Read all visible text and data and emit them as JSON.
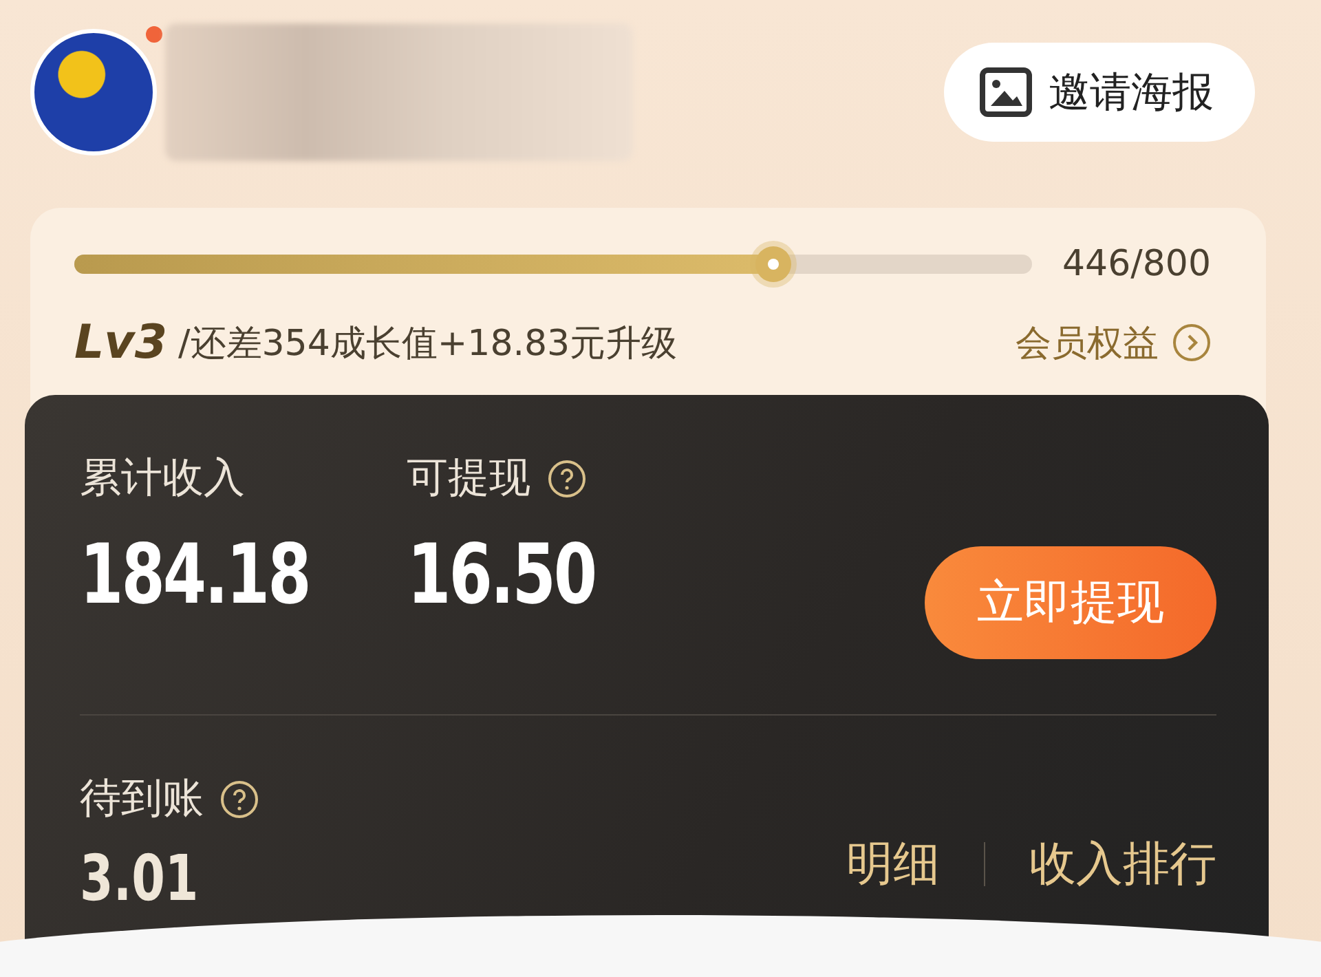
{
  "profile": {
    "has_notification": true
  },
  "invite_button": {
    "label": "邀请海报"
  },
  "level_card": {
    "level": 0.73,
    "progress": "446/800",
    "level_name": "Lv3",
    "upgrade_hint": "/还差354成长值+18.83元升级",
    "benefits_link": "会员权益"
  },
  "earnings": {
    "stats": [
      {
        "label": "累计收入",
        "value": "184.18",
        "has_help": false
      },
      {
        "label": "可提现",
        "value": "16.50",
        "has_help": true
      }
    ],
    "withdraw_button": "立即提现",
    "pending": {
      "label": "待到账",
      "value": "3.01",
      "has_help": true
    },
    "links": [
      "明细",
      "收入排行"
    ]
  }
}
